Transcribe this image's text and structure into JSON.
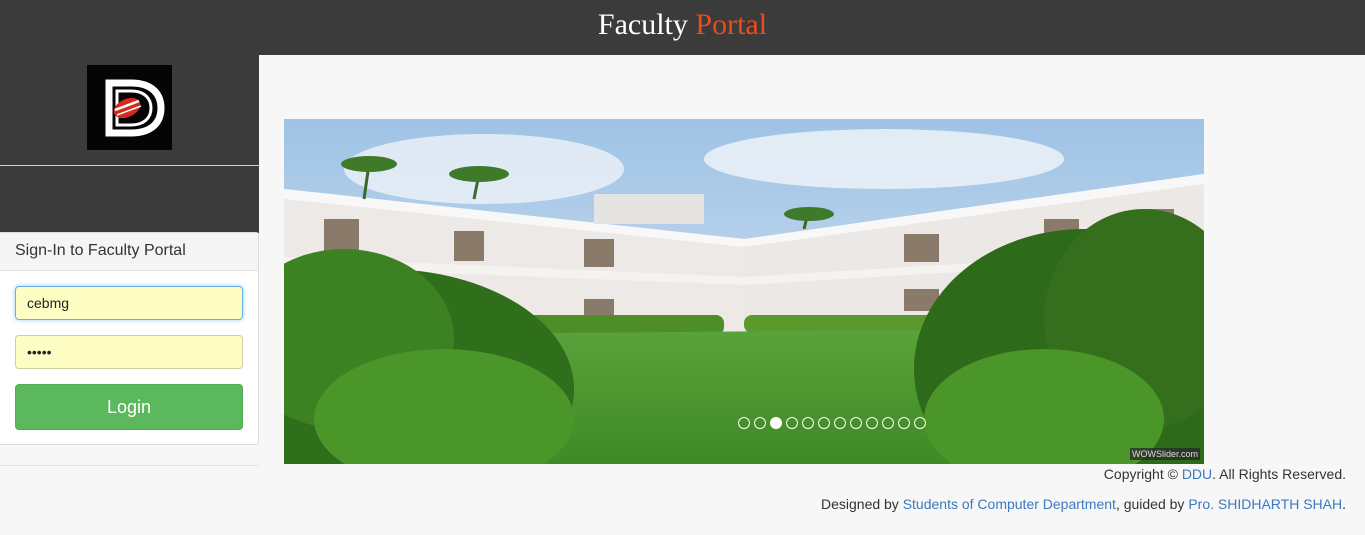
{
  "header": {
    "title_main": "Faculty",
    "title_accent": "Portal",
    "accent_color": "#ee4a1c"
  },
  "login": {
    "heading": "Sign-In to Faculty Portal",
    "username_value": "cebmg",
    "password_value": "•••••",
    "button_label": "Login",
    "button_color": "#5cb85c"
  },
  "slider": {
    "dot_count": 12,
    "active_dot_index": 2,
    "watermark": "WOWSlider.com"
  },
  "footer": {
    "copyright_prefix": "Copyright ©",
    "copyright_link": "DDU",
    "copyright_suffix": ". All Rights Reserved.",
    "designed_prefix": "Designed by",
    "designed_link": "Students of Computer Department",
    "guided_text": ", guided by",
    "guide_link": "Pro. SHIDHARTH SHAH",
    "end": "."
  }
}
